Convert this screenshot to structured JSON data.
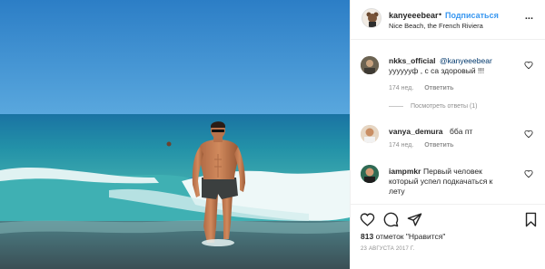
{
  "post": {
    "username": "kanyeeebear",
    "separator": "•",
    "follow_label": "Подписаться",
    "location": "Nice Beach, the French Riviera",
    "more_label": "..."
  },
  "comments": [
    {
      "username": "nkks_official",
      "mention": "@kanyeeebear",
      "text": "ууууууф , с  са здоровый !!!",
      "age": "174 нед.",
      "reply_label": "Ответить"
    },
    {
      "username": "vanya_demura",
      "text": "ббa пт",
      "age": "174 нед.",
      "reply_label": "Ответить"
    },
    {
      "username": "iampmkr",
      "text_line1": "Первый человек",
      "text_line2": "который успел подкачаться к",
      "text_line3": "лету"
    }
  ],
  "view_replies_label": "Посмотреть ответы (1)",
  "likes": {
    "count": "813",
    "text": "отметок \"Нравится\""
  },
  "date": "23 АВГУСТА 2017 Г.",
  "icons": [
    "heart-icon",
    "comment-icon",
    "share-icon",
    "bookmark-icon",
    "more-icon"
  ],
  "colors": {
    "link": "#3897f0",
    "mention": "#00376b",
    "muted": "#8e8e8e",
    "sky": "#2a86c9",
    "sea": "#1f7fa4"
  }
}
